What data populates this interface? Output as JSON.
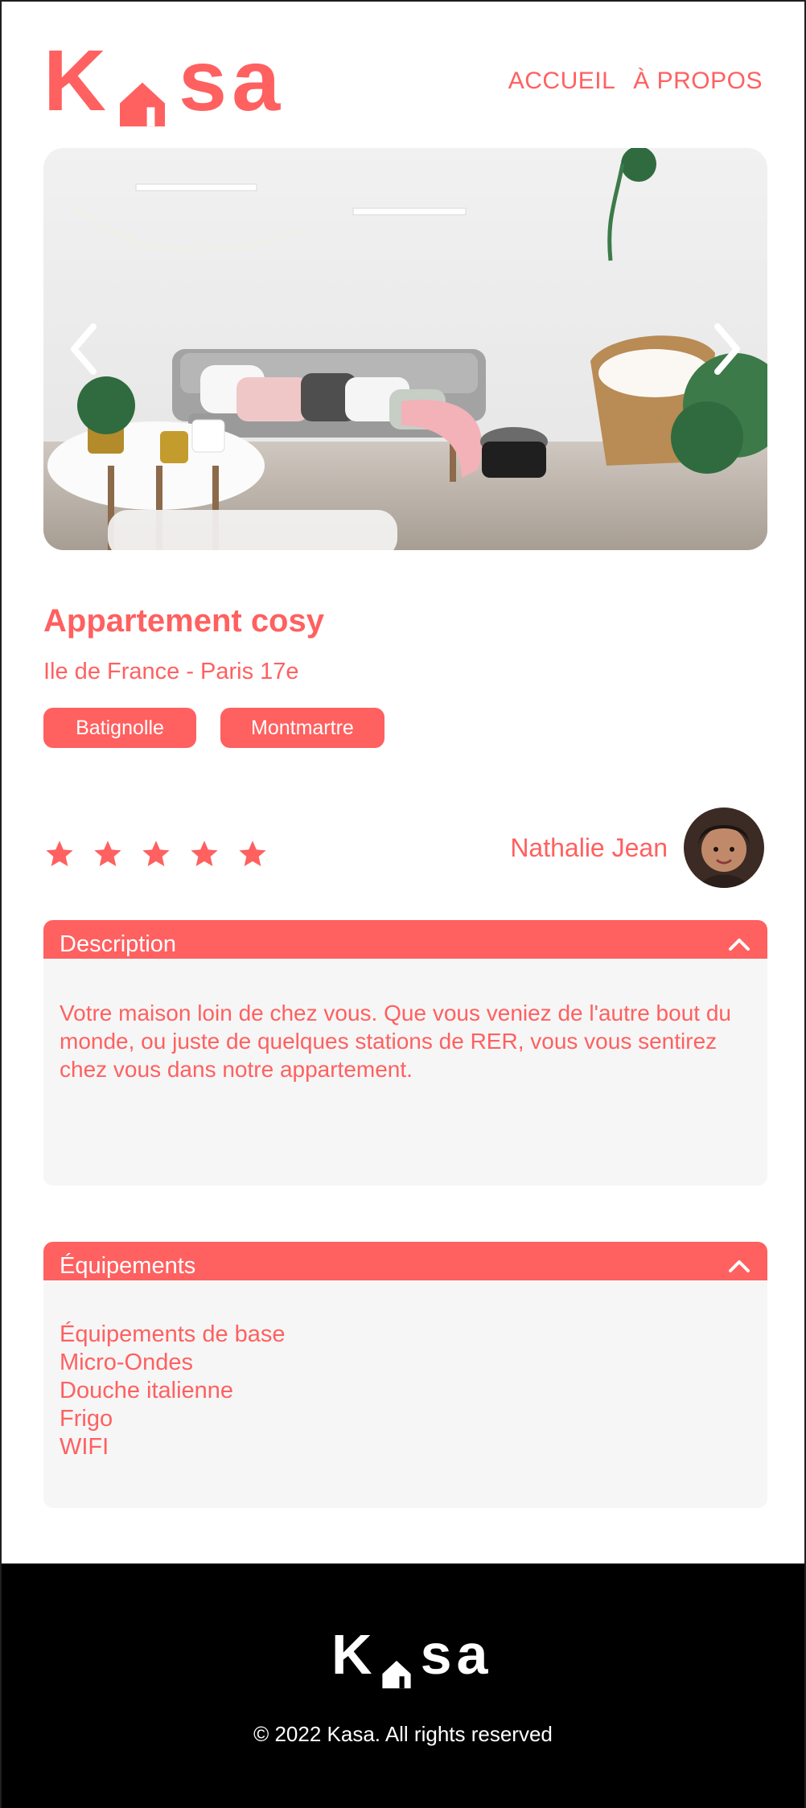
{
  "brand": {
    "name": "Kasa",
    "accent": "#FF6060",
    "footer_bg": "#000000"
  },
  "nav": {
    "home": "ACCUEIL",
    "about": "À PROPOS"
  },
  "listing": {
    "title": "Appartement cosy",
    "location": "Ile de France - Paris 17e",
    "tags": [
      "Batignolle",
      "Montmartre"
    ],
    "rating": 5,
    "rating_max": 5,
    "host_name": "Nathalie Jean"
  },
  "description": {
    "header": "Description",
    "text": "Votre maison loin de chez vous. Que vous veniez de l'autre bout du monde, ou juste de quelques stations de RER, vous vous sentirez chez vous dans notre appartement."
  },
  "equipments": {
    "header": "Équipements",
    "items": [
      "Équipements de base",
      "Micro-Ondes",
      "Douche italienne",
      "Frigo",
      "WIFI"
    ]
  },
  "footer": {
    "copyright": "© 2022 Kasa. All rights reserved"
  },
  "icons": {
    "left_arrow": "chevron-left-icon",
    "right_arrow": "chevron-right-icon",
    "collapse": "chevron-up-icon",
    "star": "star-icon",
    "house": "house-icon"
  }
}
